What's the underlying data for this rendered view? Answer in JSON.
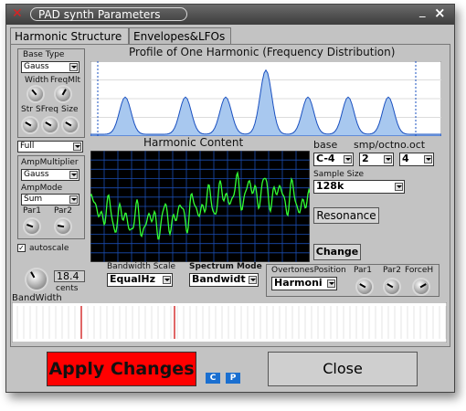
{
  "window": {
    "title": "PAD synth Parameters",
    "close_glyph": "×",
    "min_glyph": "_",
    "close_left_glyph": "✕"
  },
  "tabs": [
    {
      "label": "Harmonic Structure"
    },
    {
      "label": "Envelopes&LFOs"
    }
  ],
  "profile": {
    "title": "Profile of One Harmonic (Frequency Distribution)"
  },
  "base_type": {
    "label": "Base Type",
    "value": "Gauss",
    "width_label": "Width",
    "freqmlt_label": "FreqMlt",
    "str_label": "Str",
    "sfreq_label": "SFreq",
    "size_label": "Size"
  },
  "full_select": {
    "value": "Full"
  },
  "amp": {
    "multiplier_label": "AmpMultiplier",
    "multiplier_value": "Gauss",
    "mode_label": "AmpMode",
    "mode_value": "Sum",
    "par1_label": "Par1",
    "par2_label": "Par2"
  },
  "autoscale": {
    "label": "autoscale",
    "checked": true
  },
  "harmonic_content": {
    "title": "Harmonic Content"
  },
  "base": {
    "label": "base",
    "value": "C-4"
  },
  "smp_oct": {
    "label": "smp/oct",
    "value": "2"
  },
  "no_oct": {
    "label": "no.oct",
    "value": "4"
  },
  "sample_size": {
    "label": "Sample Size",
    "value": "128k"
  },
  "resonance_button": {
    "label": "Resonance"
  },
  "change_button": {
    "label": "Change"
  },
  "bandwidth": {
    "value": "18.4",
    "unit": "cents",
    "label": "BandWidth"
  },
  "bandwidth_scale": {
    "label": "Bandwidth Scale",
    "value": "EqualHz"
  },
  "spectrum_mode": {
    "label": "Spectrum Mode",
    "value": "Bandwidt"
  },
  "overtones": {
    "label": "OvertonesPosition",
    "value": "Harmoni",
    "par1_label": "Par1",
    "par2_label": "Par2",
    "forceh_label": "ForceH"
  },
  "apply_button": {
    "label": "Apply Changes"
  },
  "copy_button": {
    "label": "C"
  },
  "paste_button": {
    "label": "P"
  },
  "close_button": {
    "label": "Close"
  },
  "colors": {
    "apply_bg": "#ff0000",
    "oscilloscope_bg": "#000000",
    "wave": "#33ff33",
    "grid": "#1a4cb0",
    "profile_fill": "#a8c8ef",
    "profile_line": "#1a50c0",
    "accent_marker": "#cc0000"
  }
}
